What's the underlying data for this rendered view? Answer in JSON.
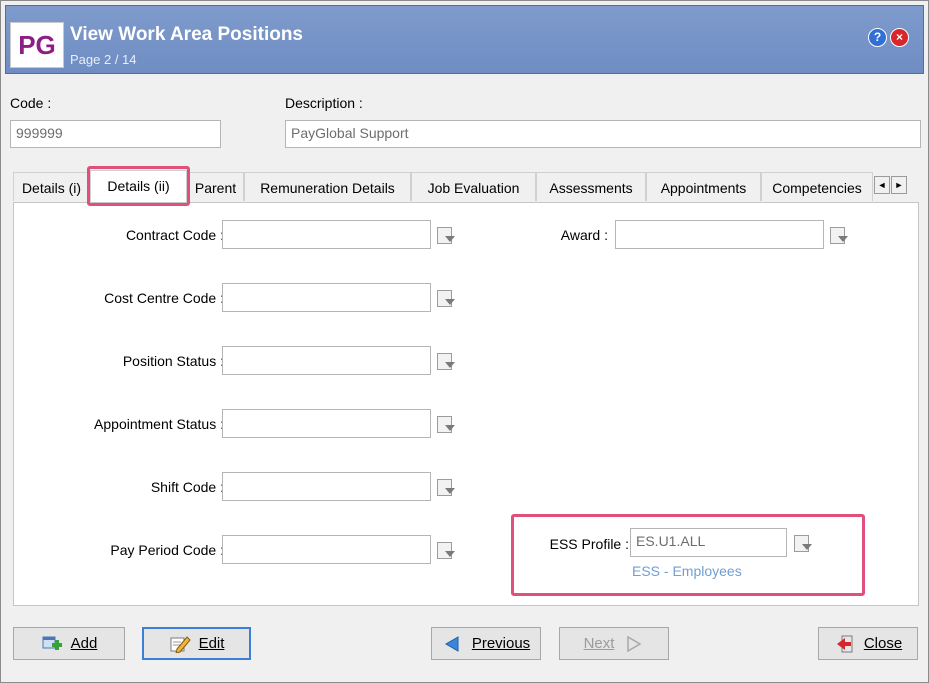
{
  "window": {
    "logo_text": "PG",
    "title": "View Work Area Positions",
    "subtitle": "Page 2 / 14",
    "help_symbol": "?",
    "close_symbol": "×"
  },
  "header": {
    "code_label": "Code :",
    "code_value": "999999",
    "description_label": "Description :",
    "description_value": "PayGlobal Support"
  },
  "tabs": [
    {
      "label": "Details (i)"
    },
    {
      "label": "Details (ii)",
      "active": true
    },
    {
      "label": "Parent"
    },
    {
      "label": "Remuneration Details"
    },
    {
      "label": "Job Evaluation"
    },
    {
      "label": "Assessments"
    },
    {
      "label": "Appointments"
    },
    {
      "label": "Competencies"
    }
  ],
  "tab_scroll": {
    "left": "◄",
    "right": "►"
  },
  "form": {
    "contract_code": {
      "label": "Contract Code :",
      "value": ""
    },
    "cost_centre_code": {
      "label": "Cost Centre Code :",
      "value": ""
    },
    "position_status": {
      "label": "Position Status :",
      "value": ""
    },
    "appointment_status": {
      "label": "Appointment Status :",
      "value": ""
    },
    "shift_code": {
      "label": "Shift Code :",
      "value": ""
    },
    "pay_period_code": {
      "label": "Pay Period Code :",
      "value": ""
    },
    "award": {
      "label": "Award :",
      "value": ""
    },
    "ess_profile": {
      "label": "ESS Profile :",
      "value": "ES.U1.ALL",
      "description": "ESS - Employees"
    }
  },
  "buttons": {
    "add": "Add",
    "edit": "Edit",
    "previous": "Previous",
    "next": "Next",
    "close": "Close"
  },
  "colors": {
    "title_bar": "#7391c6",
    "highlight": "#e0507a",
    "logo_text": "#8f1d87",
    "link_text": "#6f9fd1"
  }
}
